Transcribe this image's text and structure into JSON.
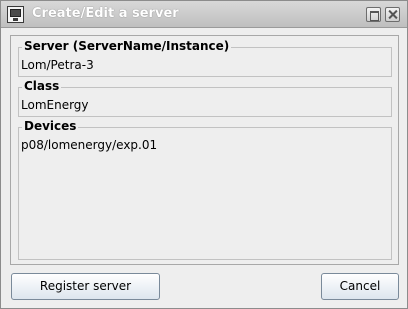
{
  "window": {
    "title": "Create/Edit a server"
  },
  "form": {
    "server": {
      "label": "Server  (ServerName/Instance)",
      "value": "Lom/Petra-3"
    },
    "class": {
      "label": "Class",
      "value": "LomEnergy"
    },
    "devices": {
      "label": "Devices",
      "value": "p08/lomenergy/exp.01"
    }
  },
  "buttons": {
    "register": "Register server",
    "cancel": "Cancel"
  },
  "icons": {
    "app": "monitor-icon",
    "maximize": "maximize-icon",
    "close": "close-icon"
  }
}
